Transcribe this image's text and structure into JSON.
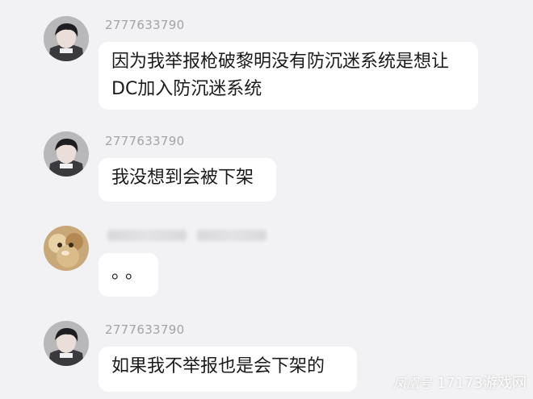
{
  "messages": [
    {
      "sender": "2777633790",
      "text": "因为我举报枪破黎明没有防沉迷系统是想让DC加入防沉迷系统"
    },
    {
      "sender": "2777633790",
      "text": "我没想到会被下架"
    },
    {
      "sender": "",
      "text": "。。"
    },
    {
      "sender": "2777633790",
      "text": "如果我不举报也是会下架的"
    }
  ],
  "watermark": {
    "source": "凤凰号",
    "site": "17173游戏网"
  },
  "colors": {
    "background": "#f2f2f4",
    "bubble": "#ffffff",
    "sender_text": "#a3a3a8",
    "message_text": "#1b1b1b"
  }
}
